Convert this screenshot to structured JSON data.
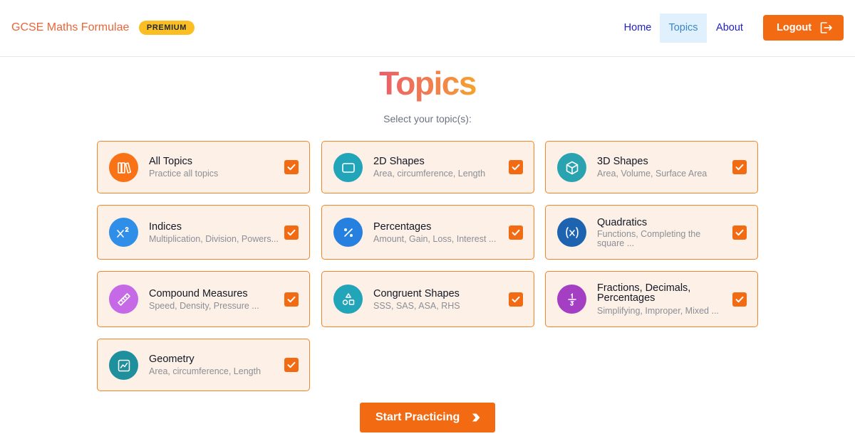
{
  "header": {
    "brand": "GCSE Maths Formulae",
    "badge": "PREMIUM",
    "nav": {
      "home": "Home",
      "topics": "Topics",
      "about": "About"
    },
    "logout_label": "Logout"
  },
  "main": {
    "title": "Topics",
    "subtitle": "Select your topic(s):",
    "cta_label": "Start Practicing"
  },
  "topics": [
    {
      "title": "All Topics",
      "subtitle": "Practice all topics",
      "icon": "books-icon",
      "color": "#f97316",
      "checked": true
    },
    {
      "title": "2D Shapes",
      "subtitle": "Area, circumference, Length",
      "icon": "rectangle-icon",
      "color": "#22a5b8",
      "checked": true
    },
    {
      "title": "3D Shapes",
      "subtitle": "Area, Volume, Surface Area",
      "icon": "cube-icon",
      "color": "#2aa3b0",
      "checked": true
    },
    {
      "title": "Indices",
      "subtitle": "Multiplication, Division, Powers...",
      "icon": "x-squared-icon",
      "color": "#2f8fe8",
      "checked": true
    },
    {
      "title": "Percentages",
      "subtitle": "Amount, Gain, Loss, Interest ...",
      "icon": "percent-icon",
      "color": "#2680e0",
      "checked": true
    },
    {
      "title": "Quadratics",
      "subtitle": "Functions, Completing the square ...",
      "icon": "variable-icon",
      "color": "#1d63b0",
      "checked": true
    },
    {
      "title": "Compound Measures",
      "subtitle": "Speed, Density, Pressure ...",
      "icon": "ruler-icon",
      "color": "#c569e6",
      "checked": true
    },
    {
      "title": "Congruent Shapes",
      "subtitle": "SSS, SAS, ASA, RHS",
      "icon": "shapes-icon",
      "color": "#22a5b8",
      "checked": true
    },
    {
      "title": "Fractions, Decimals, Percentages",
      "subtitle": "Simplifying, Improper, Mixed ...",
      "icon": "fraction-icon",
      "color": "#a43fc4",
      "checked": true
    },
    {
      "title": "Geometry",
      "subtitle": "Area, circumference, Length",
      "icon": "graph-icon",
      "color": "#1e8f9c",
      "checked": true
    }
  ]
}
